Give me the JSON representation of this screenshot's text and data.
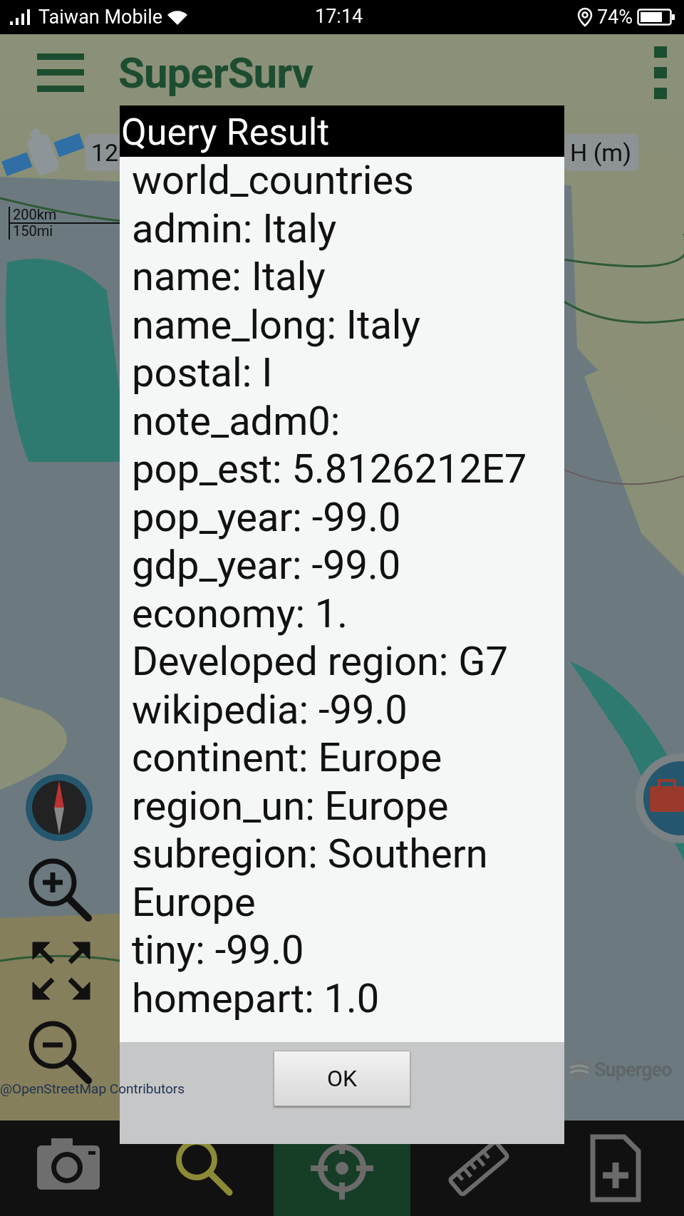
{
  "status_bar": {
    "carrier": "Taiwan Mobile",
    "time": "17:14",
    "battery": "74%"
  },
  "app_bar": {
    "title": "SuperSurv"
  },
  "map": {
    "kind": "picture",
    "gps_reading": "12",
    "height_label": "H (m)",
    "scale": [
      "200km",
      "150mi"
    ],
    "attribution": "@OpenStreetMap Contributors",
    "logo": "Supergeo"
  },
  "dialog": {
    "title": "Query Result",
    "lines": [
      "world_countries",
      "admin: Italy",
      "name: Italy",
      "name_long: Italy",
      "postal: I",
      "note_adm0:",
      "pop_est: 5.8126212E7",
      "pop_year: -99.0",
      "gdp_year: -99.0",
      "economy: 1.",
      "Developed region: G7",
      "wikipedia: -99.0",
      "continent: Europe",
      "region_un: Europe",
      "subregion: Southern Europe",
      "tiny: -99.0",
      "homepart: 1.0"
    ],
    "button": "OK"
  },
  "bottom_nav": [
    {
      "kind": "camera",
      "selected": false
    },
    {
      "kind": "search",
      "selected": false
    },
    {
      "kind": "locate",
      "selected": true
    },
    {
      "kind": "measure",
      "selected": false
    },
    {
      "kind": "new-file",
      "selected": false
    }
  ]
}
